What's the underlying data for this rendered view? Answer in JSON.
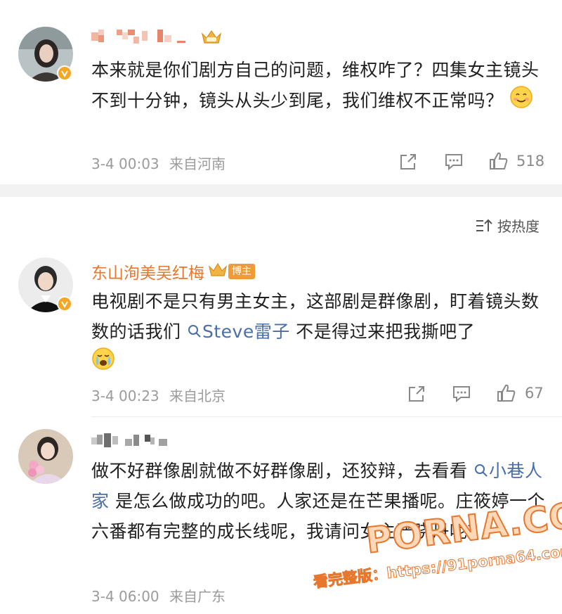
{
  "comments": [
    {
      "username": "",
      "text": "本来就是你们剧方自己的问题，维权咋了？四集女主镜头不到十分钟，镜头从头少到尾，我们维权不正常吗？",
      "emoji": "smile-emoji",
      "time": "3-4 00:03",
      "location": "来自河南",
      "likes": "518"
    },
    {
      "username": "东山洵美吴红梅",
      "badge": "博主",
      "text_before": "电视剧不是只有男主女主，这部剧是群像剧，盯着镜头数数的话我们",
      "link": "Steve雷子",
      "text_after": "不是得过来把我撕吧了",
      "emoji": "crying-emoji",
      "time": "3-4 00:23",
      "location": "来自北京",
      "likes": "67"
    },
    {
      "username": "",
      "text_before": "做不好群像剧就做不好群像剧，还狡辩，去看看",
      "link": "小巷人家",
      "text_after": "是怎么做成功的吧。人家还是在芒果播呢。庄筱婷一个六番都有完整的成长线呢，我请问女主严晓丹呢？",
      "time": "3-4 06:00",
      "location": "来自广东"
    }
  ],
  "sort": {
    "label": "按热度"
  },
  "watermark": {
    "brand": "PORNA.COM",
    "subline": "看完整版：https://91porna64.com"
  },
  "colors": {
    "accent": "#e8762c",
    "link": "#4a6ea9",
    "vip": "#f5a623"
  }
}
